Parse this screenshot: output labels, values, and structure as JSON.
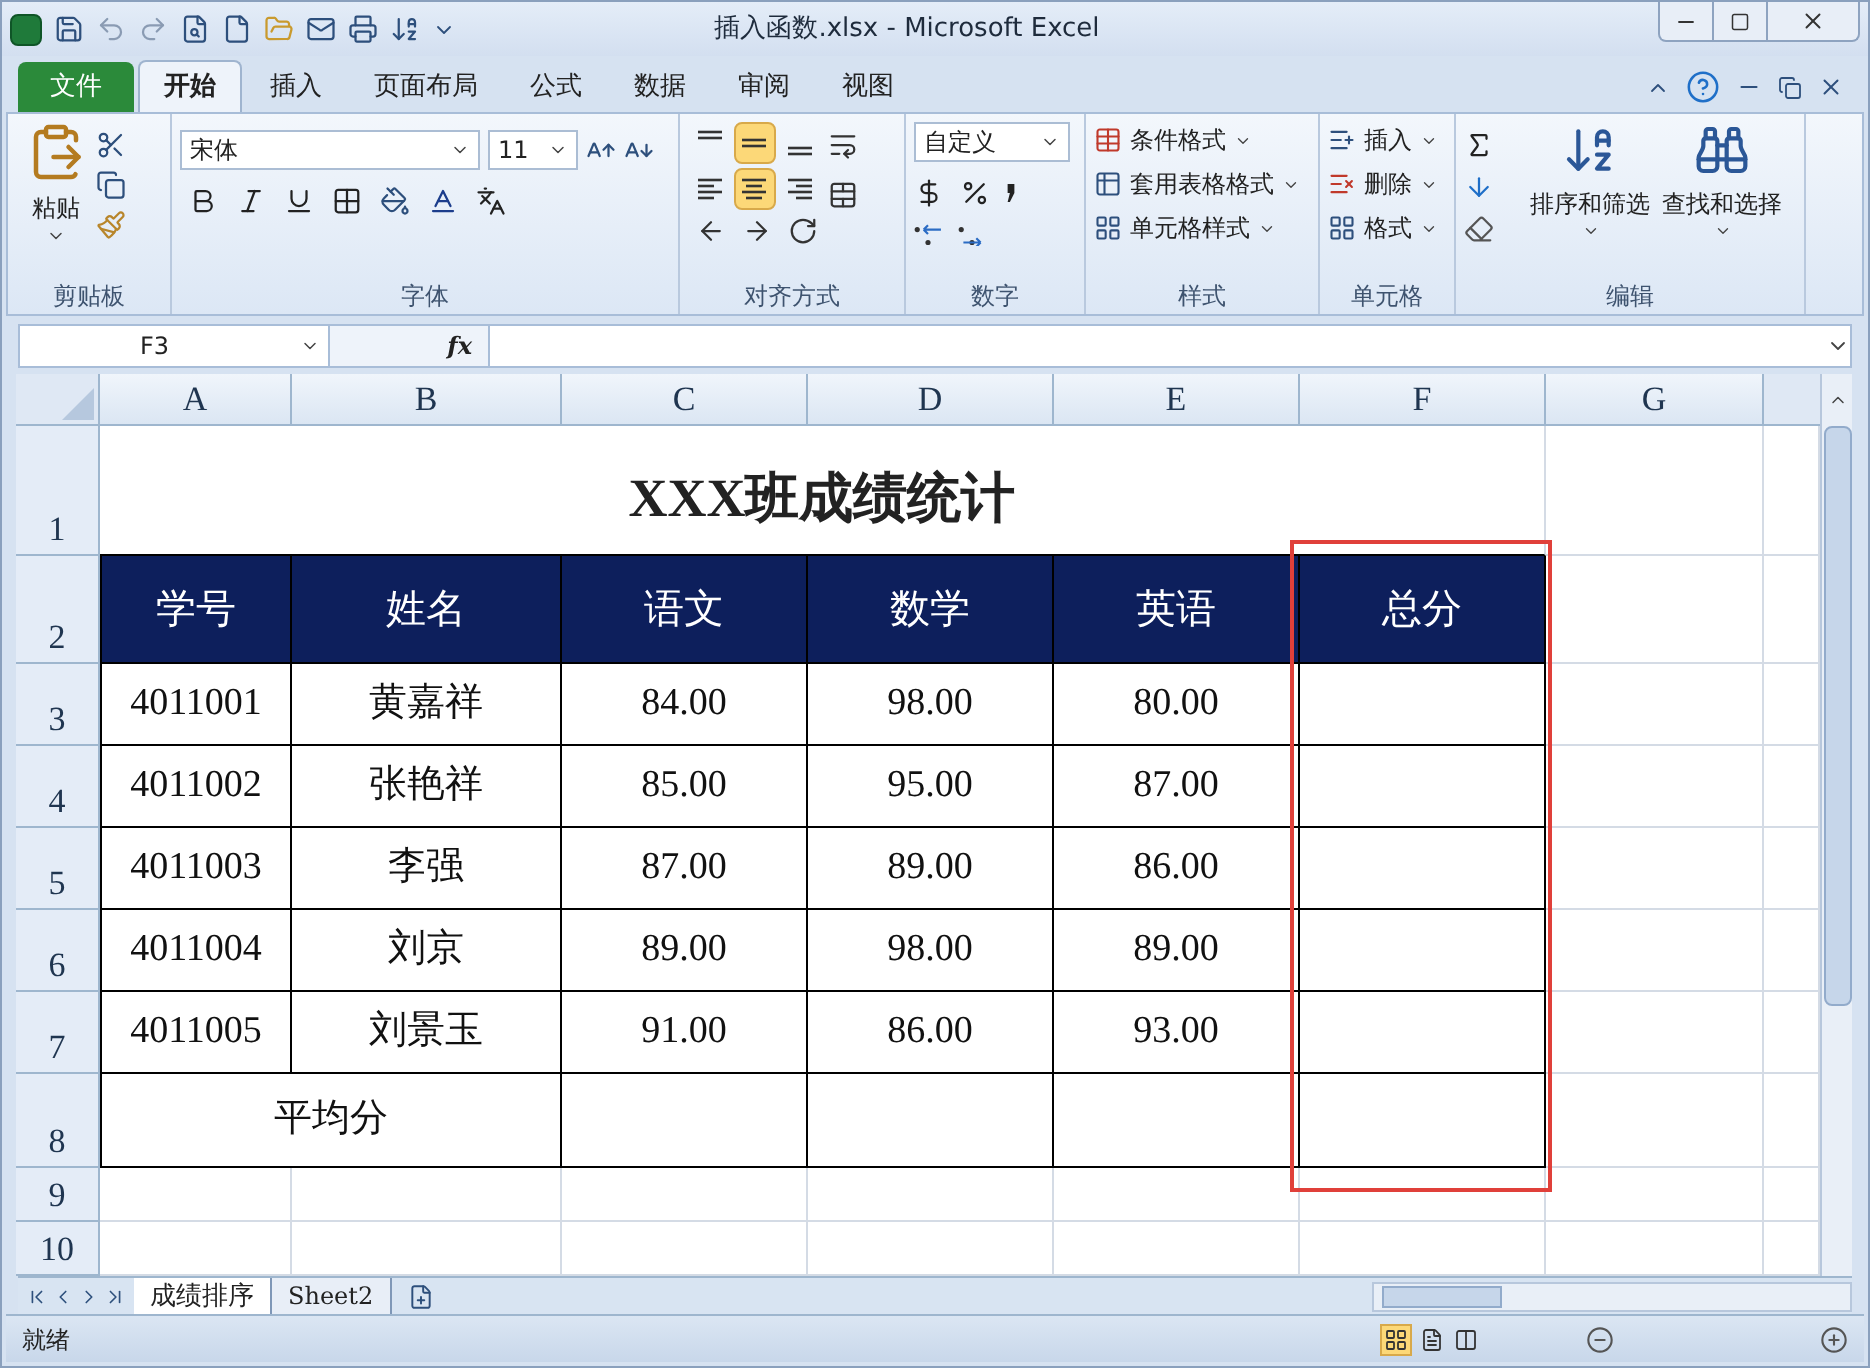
{
  "window": {
    "title": "插入函数.xlsx - Microsoft Excel"
  },
  "ribbon_tabs": [
    {
      "label": "文件",
      "kind": "file",
      "selected": false
    },
    {
      "label": "开始",
      "kind": "tab",
      "selected": true
    },
    {
      "label": "插入",
      "kind": "tab",
      "selected": false
    },
    {
      "label": "页面布局",
      "kind": "tab",
      "selected": false
    },
    {
      "label": "公式",
      "kind": "tab",
      "selected": false
    },
    {
      "label": "数据",
      "kind": "tab",
      "selected": false
    },
    {
      "label": "审阅",
      "kind": "tab",
      "selected": false
    },
    {
      "label": "视图",
      "kind": "tab",
      "selected": false
    }
  ],
  "ribbon": {
    "clipboard": {
      "paste": "粘贴",
      "label": "剪贴板"
    },
    "font": {
      "name": "宋体",
      "size": "11",
      "label": "字体"
    },
    "alignment": {
      "label": "对齐方式",
      "buttons": [
        {
          "kind": "top",
          "selected": false
        },
        {
          "kind": "middle",
          "selected": true
        },
        {
          "kind": "bottom",
          "selected": false
        },
        {
          "kind": "left",
          "selected": false
        },
        {
          "kind": "center",
          "selected": true
        },
        {
          "kind": "right",
          "selected": false
        }
      ]
    },
    "number": {
      "format": "自定义",
      "label": "数字"
    },
    "styles": {
      "label": "样式",
      "items": [
        "条件格式",
        "套用表格格式",
        "单元格样式"
      ]
    },
    "cells": {
      "label": "单元格",
      "items": [
        "插入",
        "删除",
        "格式"
      ]
    },
    "editing": {
      "label": "编辑",
      "sort": "排序和筛选",
      "find": "查找和选择"
    }
  },
  "formula_bar": {
    "name_box": "F3",
    "function_label": "fx"
  },
  "sheet": {
    "columns": [
      "A",
      "B",
      "C",
      "D",
      "E",
      "F",
      "G"
    ],
    "rows": [
      {
        "header": "1",
        "cells": [
          {
            "kind": "title",
            "text": "XXX班成绩统计",
            "colspan": 6
          }
        ]
      },
      {
        "header": "2",
        "cells": [
          {
            "kind": "header",
            "text": "学号"
          },
          {
            "kind": "header",
            "text": "姓名"
          },
          {
            "kind": "header",
            "text": "语文"
          },
          {
            "kind": "header",
            "text": "数学"
          },
          {
            "kind": "header",
            "text": "英语"
          },
          {
            "kind": "header",
            "text": "总分"
          }
        ]
      },
      {
        "header": "3",
        "cells": [
          {
            "kind": "body",
            "text": "4011001"
          },
          {
            "kind": "body",
            "text": "黄嘉祥"
          },
          {
            "kind": "body",
            "text": "84.00"
          },
          {
            "kind": "body",
            "text": "98.00"
          },
          {
            "kind": "body",
            "text": "80.00"
          },
          {
            "kind": "body"
          }
        ]
      },
      {
        "header": "4",
        "cells": [
          {
            "kind": "body",
            "text": "4011002"
          },
          {
            "kind": "body",
            "text": "张艳祥"
          },
          {
            "kind": "body",
            "text": "85.00"
          },
          {
            "kind": "body",
            "text": "95.00"
          },
          {
            "kind": "body",
            "text": "87.00"
          },
          {
            "kind": "body"
          }
        ]
      },
      {
        "header": "5",
        "cells": [
          {
            "kind": "body",
            "text": "4011003"
          },
          {
            "kind": "body",
            "text": "李强"
          },
          {
            "kind": "body",
            "text": "87.00"
          },
          {
            "kind": "body",
            "text": "89.00"
          },
          {
            "kind": "body",
            "text": "86.00"
          },
          {
            "kind": "body"
          }
        ]
      },
      {
        "header": "6",
        "cells": [
          {
            "kind": "body",
            "text": "4011004"
          },
          {
            "kind": "body",
            "text": "刘京"
          },
          {
            "kind": "body",
            "text": "89.00"
          },
          {
            "kind": "body",
            "text": "98.00"
          },
          {
            "kind": "body",
            "text": "89.00"
          },
          {
            "kind": "body"
          }
        ]
      },
      {
        "header": "7",
        "cells": [
          {
            "kind": "body",
            "text": "4011005"
          },
          {
            "kind": "body",
            "text": "刘景玉"
          },
          {
            "kind": "body",
            "text": "91.00"
          },
          {
            "kind": "body",
            "text": "86.00"
          },
          {
            "kind": "body",
            "text": "93.00"
          },
          {
            "kind": "body"
          }
        ]
      },
      {
        "header": "8",
        "cells": [
          {
            "kind": "body",
            "text": "平均分",
            "colspan": 2
          },
          {
            "kind": "body"
          },
          {
            "kind": "body"
          },
          {
            "kind": "body"
          },
          {
            "kind": "body"
          }
        ]
      },
      {
        "header": "9",
        "cells": []
      },
      {
        "header": "10",
        "cells": []
      }
    ]
  },
  "sheet_tabs": [
    {
      "label": "成绩排序",
      "selected": true
    },
    {
      "label": "Sheet2",
      "selected": false
    }
  ],
  "status_bar": {
    "text": "就绪"
  }
}
